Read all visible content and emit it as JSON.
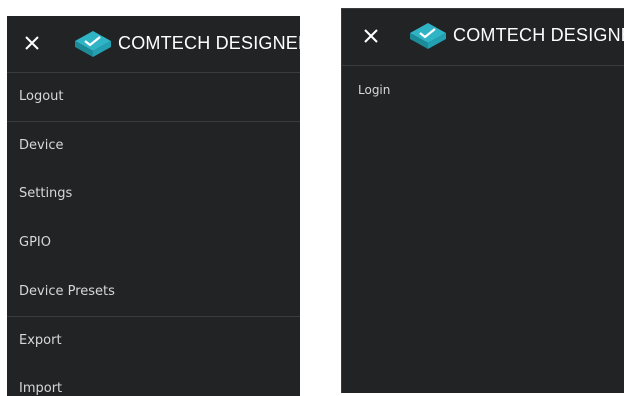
{
  "app": {
    "brand_name": "COMTECH DESIGNER",
    "accent_color": "#2fb4c6"
  },
  "left_panel": {
    "menu": [
      {
        "label": "Logout"
      },
      {
        "label": "Device"
      },
      {
        "label": "Settings"
      },
      {
        "label": "GPIO"
      },
      {
        "label": "Device Presets"
      },
      {
        "label": "Export"
      },
      {
        "label": "Import"
      }
    ]
  },
  "right_panel": {
    "menu": [
      {
        "label": "Login"
      }
    ]
  },
  "icons": {
    "close": "close-icon",
    "logo": "comtech-logo-icon"
  }
}
